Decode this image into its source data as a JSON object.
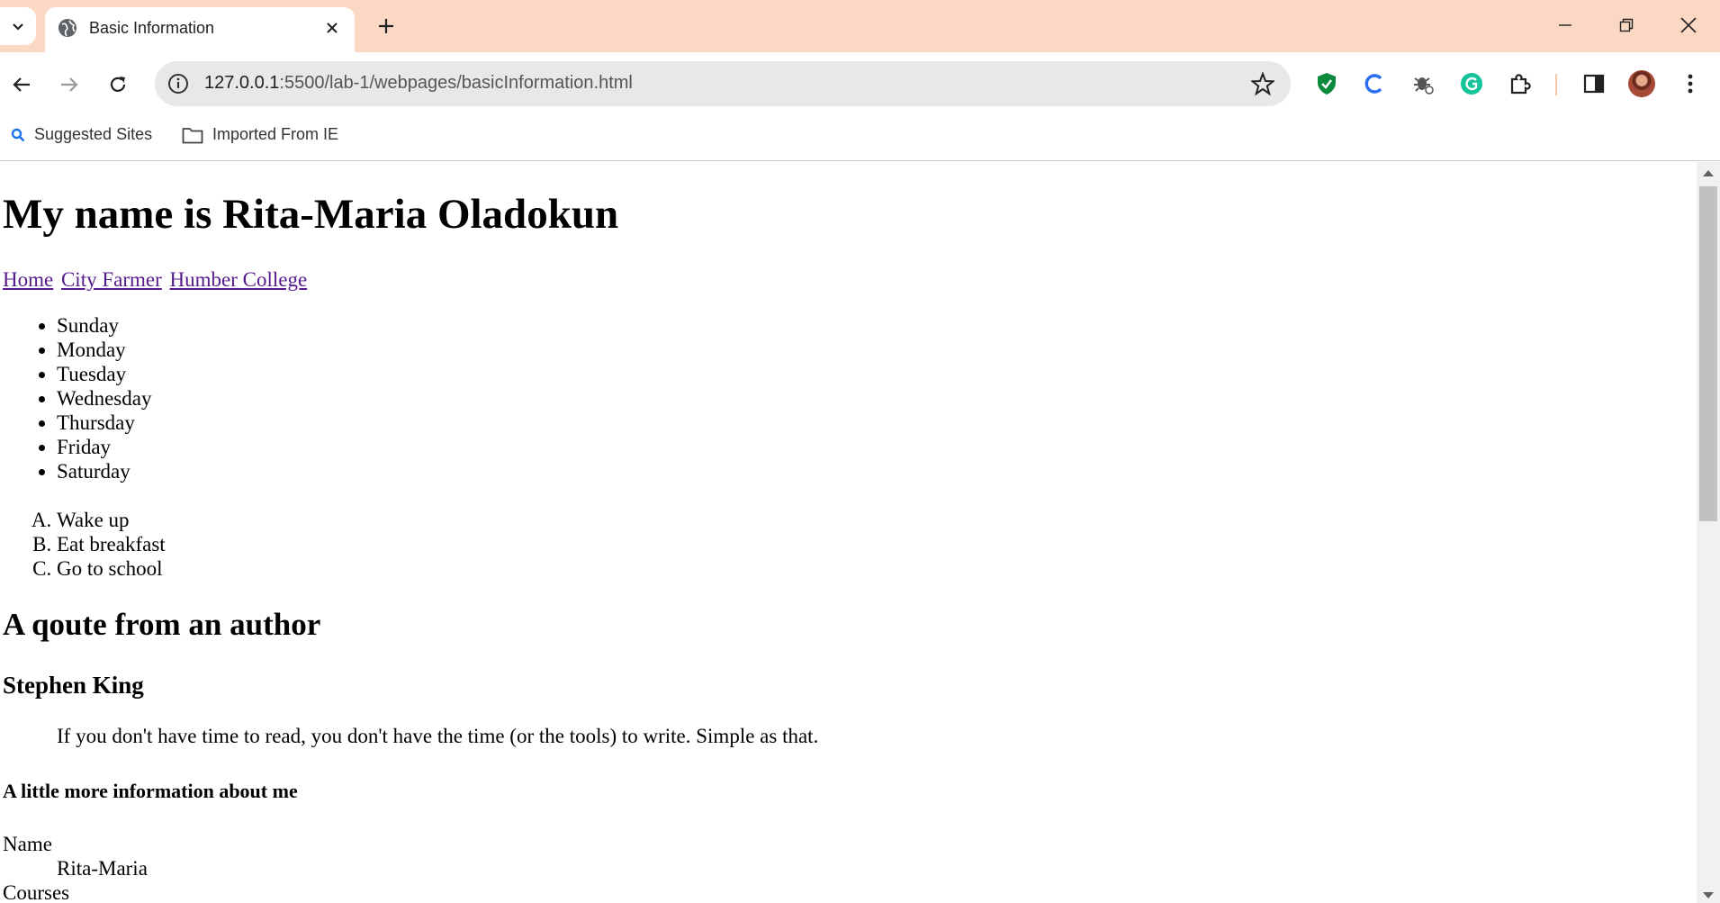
{
  "browser": {
    "tab_title": "Basic Information",
    "url_host": "127.0.0.1",
    "url_rest": ":5500/lab-1/webpages/basicInformation.html",
    "bookmarks": [
      "Suggested Sites",
      "Imported From IE"
    ],
    "colors": {
      "tabstrip": "#fbd8c4",
      "omnibox": "#e8e8e8",
      "visited_link": "#551a8b"
    }
  },
  "page": {
    "heading": "My name is Rita-Maria Oladokun",
    "nav_links": [
      "Home",
      "City Farmer",
      "Humber College"
    ],
    "days": [
      "Sunday",
      "Monday",
      "Tuesday",
      "Wednesday",
      "Thursday",
      "Friday",
      "Saturday"
    ],
    "routine": [
      "Wake up",
      "Eat breakfast",
      "Go to school"
    ],
    "quote_heading": "A qoute from an author",
    "author": "Stephen King",
    "quote": "If you don't have time to read, you don't have the time (or the tools) to write. Simple as that.",
    "about_heading": "A little more information about me",
    "details": [
      {
        "term": "Name",
        "desc": "Rita-Maria"
      },
      {
        "term": "Courses"
      }
    ]
  }
}
